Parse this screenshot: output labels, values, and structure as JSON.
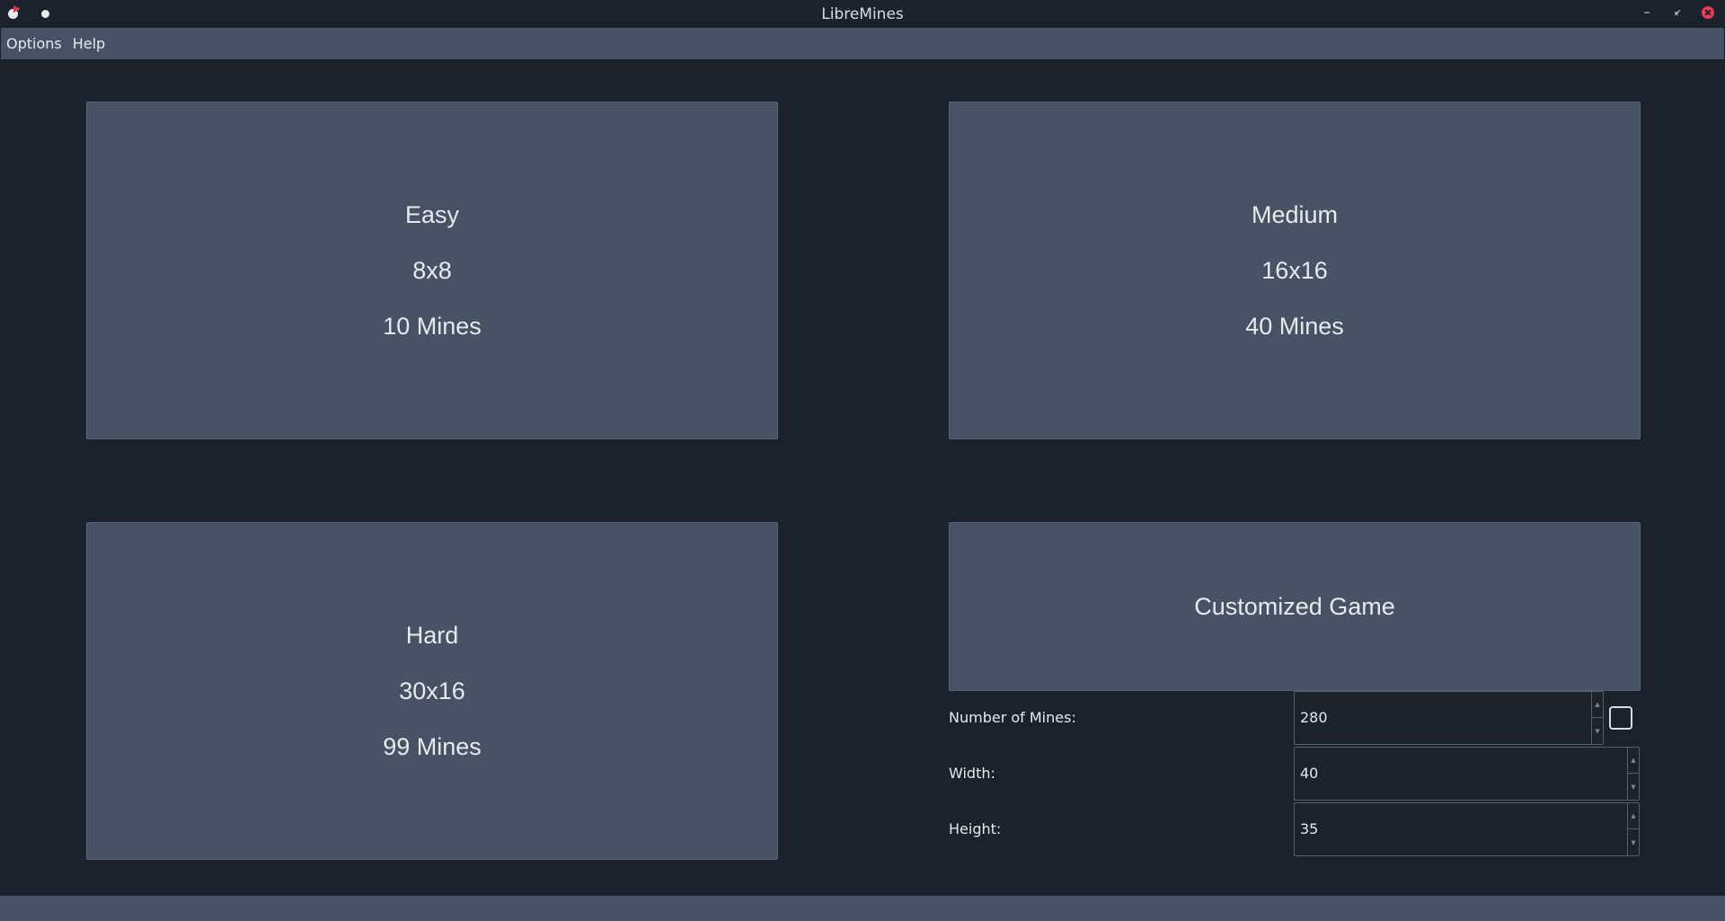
{
  "window": {
    "title": "LibreMines"
  },
  "menubar": {
    "items": [
      {
        "label": "Options"
      },
      {
        "label": "Help"
      }
    ]
  },
  "difficulties": {
    "easy": {
      "name": "Easy",
      "size": "8x8",
      "mines": "10 Mines"
    },
    "medium": {
      "name": "Medium",
      "size": "16x16",
      "mines": "40 Mines"
    },
    "hard": {
      "name": "Hard",
      "size": "30x16",
      "mines": "99 Mines"
    },
    "custom": {
      "name": "Customized Game"
    }
  },
  "custom_fields": {
    "mines": {
      "label": "Number of Mines:",
      "value": "280"
    },
    "width": {
      "label": "Width:",
      "value": "40"
    },
    "height": {
      "label": "Height:",
      "value": "35"
    },
    "mines_percentage_checkbox": {
      "checked": false
    }
  },
  "icons": {
    "app": "minesweeper-bomb-flag-icon",
    "minimize": "minimize-icon",
    "maximize": "restore-icon",
    "close": "close-icon",
    "spin_up": "chevron-up-icon",
    "spin_down": "chevron-down-icon"
  },
  "colors": {
    "background": "#1b222c",
    "panel": "#475364",
    "close_button": "#ed3b55",
    "text": "#e6e9ee"
  }
}
